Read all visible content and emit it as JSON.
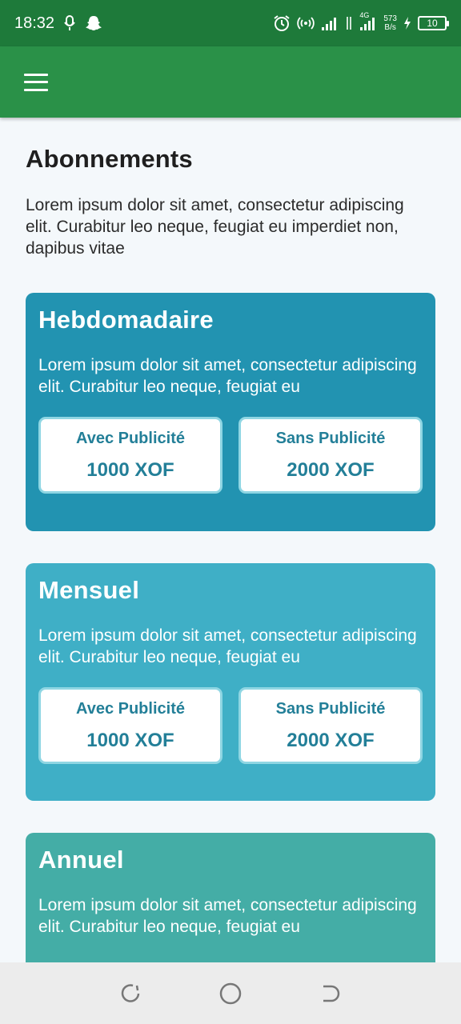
{
  "status_bar": {
    "time": "18:32",
    "network_type": "4G",
    "net_speed_value": "573",
    "net_speed_unit": "B/s",
    "battery_level": "10"
  },
  "app_bar": {
    "menu_icon": "hamburger-menu-icon"
  },
  "page": {
    "title": "Abonnements",
    "description": "Lorem ipsum dolor sit amet, consectetur adipiscing elit. Curabitur leo neque, feugiat eu imperdiet non, dapibus vitae"
  },
  "plans": [
    {
      "title": "Hebdomadaire",
      "description": "Lorem ipsum dolor sit amet, consectetur adipiscing elit. Curabitur leo neque, feugiat eu",
      "color": "#2293b1",
      "options": [
        {
          "label": "Avec Publicité",
          "price": "1000 XOF"
        },
        {
          "label": "Sans Publicité",
          "price": "2000 XOF"
        }
      ]
    },
    {
      "title": "Mensuel",
      "description": "Lorem ipsum dolor sit amet, consectetur adipiscing elit. Curabitur leo neque, feugiat eu",
      "color": "#3fafc6",
      "options": [
        {
          "label": "Avec Publicité",
          "price": "1000 XOF"
        },
        {
          "label": "Sans Publicité",
          "price": "2000 XOF"
        }
      ]
    },
    {
      "title": "Annuel",
      "description": "Lorem ipsum dolor sit amet, consectetur adipiscing elit. Curabitur leo neque, feugiat eu",
      "color": "#44ada6"
    }
  ],
  "colors": {
    "status_bar": "#1e7a3a",
    "app_bar": "#2a9148",
    "option_text": "#237f98"
  },
  "nav_bar": {
    "recents_icon": "recents-icon",
    "home_icon": "home-icon",
    "back_icon": "back-icon"
  }
}
